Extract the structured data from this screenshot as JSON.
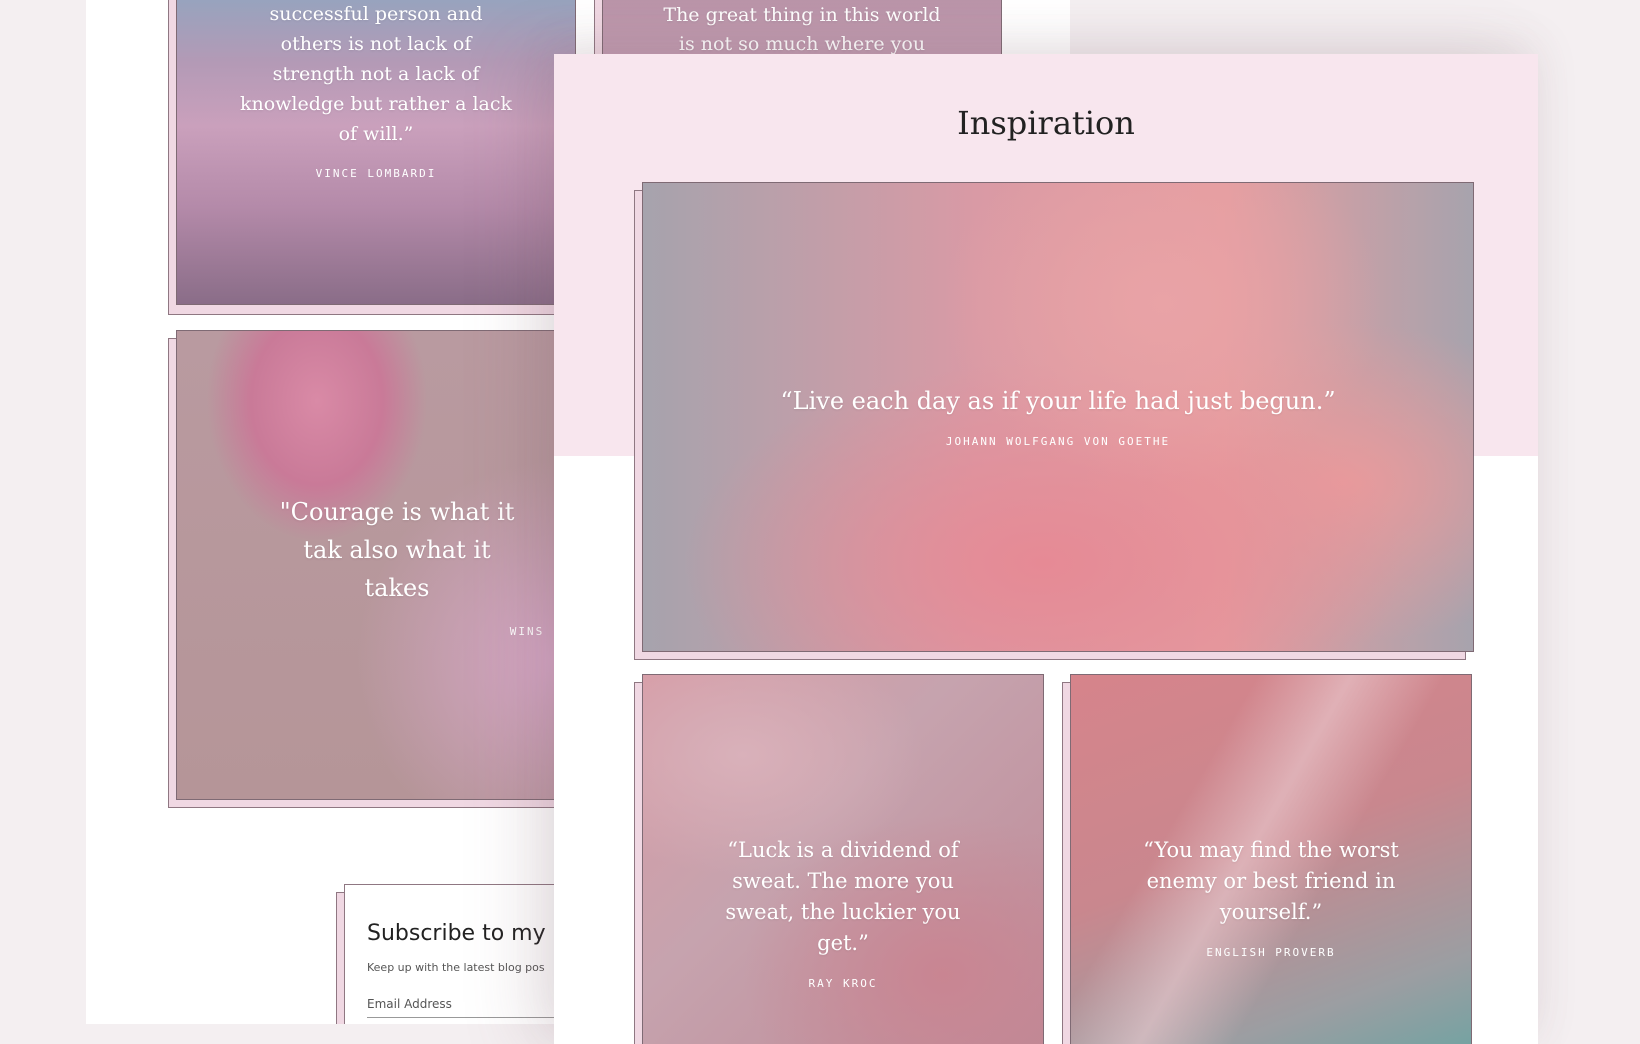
{
  "background_page": {
    "card1": {
      "quote": "successful person and others is not lack of strength not a lack of knowledge but rather a lack of will.”",
      "author": "VINCE LOMBARDI"
    },
    "card2": {
      "quote": "\"Courage is what it tak also what it takes",
      "author": "WINS"
    },
    "card3": {
      "quote": "The great thing in this world is not so much where you"
    },
    "subscribe": {
      "title": "Subscribe to my n",
      "description": "Keep up with the latest blog pos",
      "email_placeholder": "Email Address"
    }
  },
  "front_page": {
    "title": "Inspiration",
    "cards": [
      {
        "quote": "“Live each day as if your life had just begun.”",
        "author": "JOHANN WOLFGANG VON GOETHE"
      },
      {
        "quote": "“Luck is a dividend of sweat. The more you sweat, the luckier you get.”",
        "author": "RAY KROC"
      },
      {
        "quote": "“You may find the worst enemy or best friend in yourself.”",
        "author": "ENGLISH PROVERB"
      }
    ]
  },
  "colors": {
    "header_band": "#f8e6ee",
    "card_shadow": "#f0d8e3",
    "border": "#8f7782"
  }
}
